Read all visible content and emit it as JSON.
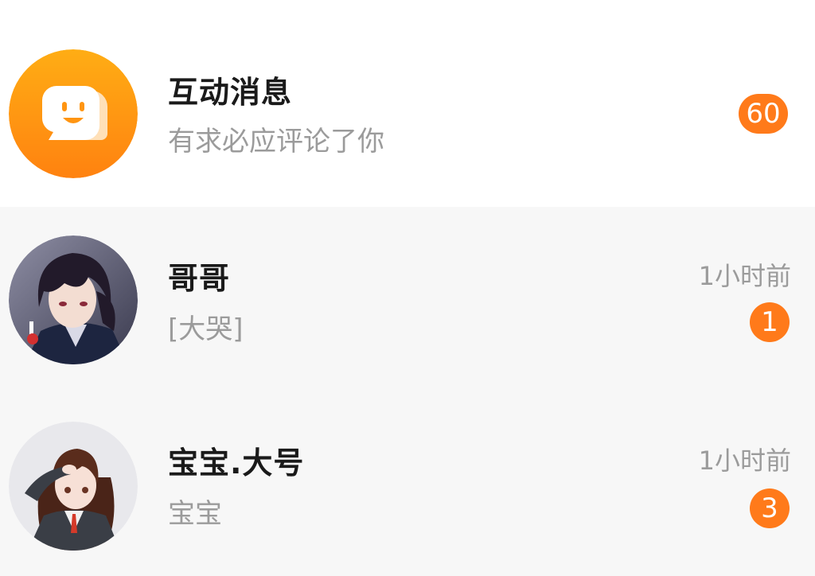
{
  "messages": [
    {
      "title": "互动消息",
      "subtitle": "有求必应评论了你",
      "time": "",
      "badge": "60",
      "avatar_icon": "smiling-chat-bubble-icon",
      "accent_color": "#ff8a10"
    },
    {
      "title": "哥哥",
      "subtitle": "[大哭]",
      "time": "1小时前",
      "badge": "1",
      "avatar_icon": "anime-boy-avatar"
    },
    {
      "title": "宝宝.大号",
      "subtitle": "宝宝",
      "time": "1小时前",
      "badge": "3",
      "avatar_icon": "anime-girl-salute-avatar"
    }
  ],
  "colors": {
    "badge": "#ff7a1a",
    "title": "#1a1a1a",
    "secondary_text": "#9b9b9b",
    "row_background": "#f7f7f7"
  }
}
